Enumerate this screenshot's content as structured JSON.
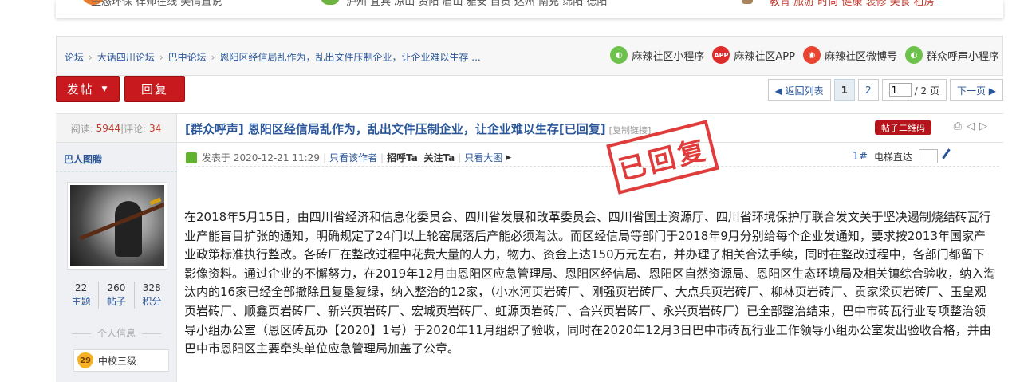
{
  "topnav": {
    "left": "生态环保  律师在线  美情直说",
    "mid": "泸州  宜宾  凉山  资阳  眉山  雅安  自贡  达州  南充  绵阳  德阳",
    "right": "教育  旅游  时尚  健康  装修  美食  租房"
  },
  "breadcrumb": [
    "论坛",
    "大话四川论坛",
    "巴中论坛",
    "恩阳区经信局乱作为，乱出文件压制企业，让企业难以生存 ..."
  ],
  "apps": [
    {
      "icon": "wechat-icon",
      "label": "麻辣社区小程序"
    },
    {
      "icon": "app-icon",
      "icon_text": "APP",
      "label": "麻辣社区APP"
    },
    {
      "icon": "weibo-icon",
      "label": "麻辣社区微博号"
    },
    {
      "icon": "wechat-icon",
      "label": "群众呼声小程序"
    }
  ],
  "actions": {
    "post_label": "发帖",
    "reply_label": "回复"
  },
  "pager": {
    "back": "◀ 返回列表",
    "page1": "1",
    "page2": "2",
    "current_input": "1",
    "total": "/ 2 页",
    "next": "下一页 ▶"
  },
  "stats": {
    "views_label": "阅读:",
    "views": "5944",
    "sep": "|",
    "replies_label": "评论:",
    "replies": "34"
  },
  "thread": {
    "title": "[群众呼声] 恩阳区经信局乱作为，乱出文件压制企业，让企业难以生存[已回复]",
    "copy_link": "[复制链接]",
    "qrcode": "帖子二维码",
    "stamp": "已回复"
  },
  "author": {
    "name": "巴人图腾",
    "topics": "22",
    "topics_label": "主题",
    "posts": "260",
    "posts_label": "帖子",
    "points": "328",
    "points_label": "积分",
    "personal_info": "个人信息",
    "level": "29",
    "rank": "中校三级"
  },
  "post_meta": {
    "posted": "发表于 2020-12-21 11:29",
    "only_author": "只看该作者",
    "greet": "招呼Ta",
    "follow": "关注Ta",
    "big_image": "只看大图",
    "floor": "1#",
    "elevator": "电梯直达"
  },
  "body": "在2018年5月15日，由四川省经济和信息化委员会、四川省发展和改革委员会、四川省国土资源厅、四川省环境保护厅联合发文关于坚决遏制烧结砖瓦行业产能盲目扩张的通知，明确规定了24门以上轮窑属落后产能必须淘汰。而区经信局等部门于2018年9月分别给每个企业发通知，要求按2013年国家产业政策标准执行整改。各砖厂在整改过程中花费大量的人力，物力、资金上达150万元左右，并办理了相关合法手续，同时在整改过程中，各部门都留下影像资料。通过企业的不懈努力，在2019年12月由恩阳区应急管理局、恩阳区经信局、恩阳区自然资源局、恩阳区生态环境局及相关镇综合验收，纳入淘汰内的16家已经全部撤除且复垦复绿，纳入整治的12家，（小水河页岩砖厂、刚强页岩砖厂、大点兵页岩砖厂、柳林页岩砖厂、贡家梁页岩砖厂、玉皇观页岩砖厂、顺鑫页岩砖厂、新兴页岩砖厂、宏城页岩砖厂、虹源页岩砖厂、合兴页岩砖厂、永兴页岩砖厂）已全部整治结束，巴中市砖瓦行业专项整治领导小组办公室（恩区砖瓦办【2020】1号）于2020年11月组织了验收，同时在2020年12月3日巴中市砖瓦行业工作领导小组办公室发出验收合格，并由巴中市恩阳区主要牵头单位应急管理局加盖了公章。"
}
